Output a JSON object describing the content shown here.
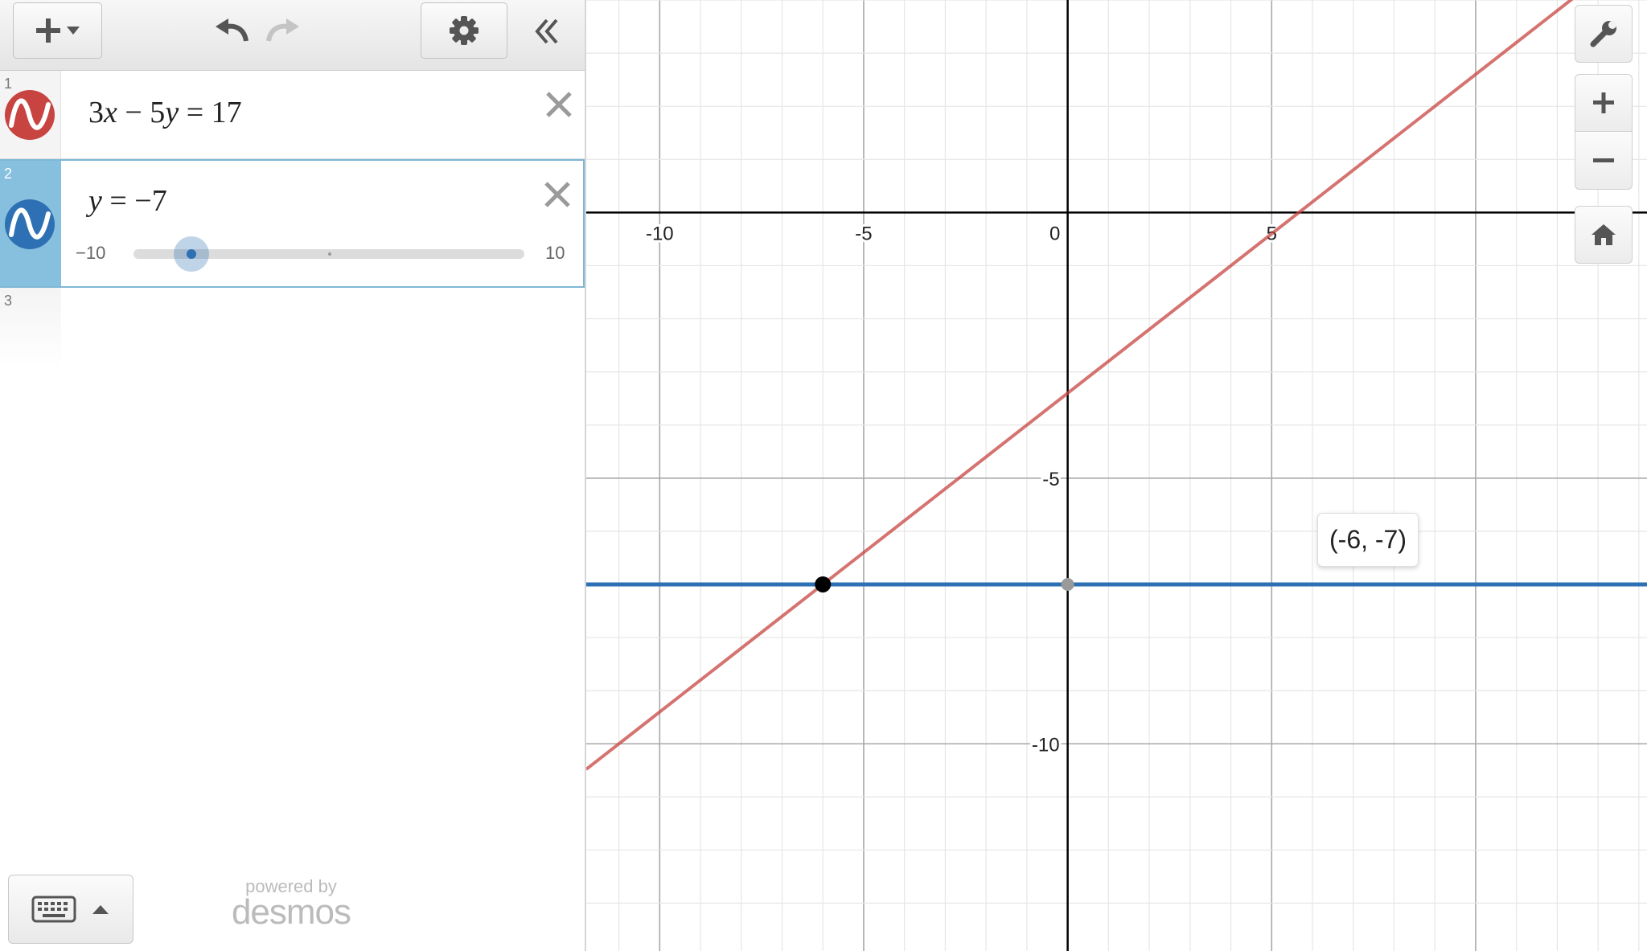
{
  "expressions": [
    {
      "number": "1",
      "latex_parts": [
        "3",
        "x",
        " − 5",
        "y",
        " = 17"
      ],
      "color": "#c74440"
    },
    {
      "number": "2",
      "latex_parts": [
        "y",
        " = −7"
      ],
      "color": "#2d70b3",
      "slider": {
        "min_label": "−10",
        "max_label": "10",
        "value": -7
      }
    },
    {
      "number": "3"
    }
  ],
  "branding": {
    "powered_by": "powered by",
    "brand": "desmos"
  },
  "tooltip": {
    "text": "(-6, -7)"
  },
  "icons": {
    "add": "plus-icon",
    "add_caret": "chevron-down-icon",
    "undo": "undo-icon",
    "redo": "redo-icon",
    "settings": "gear-icon",
    "collapse": "double-chevron-left-icon",
    "delete": "close-icon",
    "keyboard": "keyboard-icon",
    "keyboard_caret": "triangle-up-icon",
    "wrench": "wrench-icon",
    "zoom_in": "plus-icon",
    "zoom_out": "minus-icon",
    "home": "home-icon"
  },
  "chart_data": {
    "type": "line",
    "x_range": [
      -11.8,
      14.2
    ],
    "y_range": [
      -13.9,
      4.0
    ],
    "grid": true,
    "minor_step": 1,
    "major_step": 5,
    "x_tick_labels": [
      "-10",
      "-5",
      "0",
      "5"
    ],
    "y_tick_labels": [
      "-5",
      "-10"
    ],
    "series": [
      {
        "equation": "3x − 5y = 17",
        "color": "#c74440",
        "slope": 0.6,
        "intercept": -3.4
      },
      {
        "equation": "y = −7",
        "color": "#2d70b3",
        "slope": 0,
        "intercept": -7
      }
    ],
    "points": [
      {
        "x": -6,
        "y": -7,
        "label": "(-6, -7)",
        "color": "#000000"
      },
      {
        "x": 0,
        "y": -7,
        "color": "#9a9a9a"
      }
    ]
  }
}
